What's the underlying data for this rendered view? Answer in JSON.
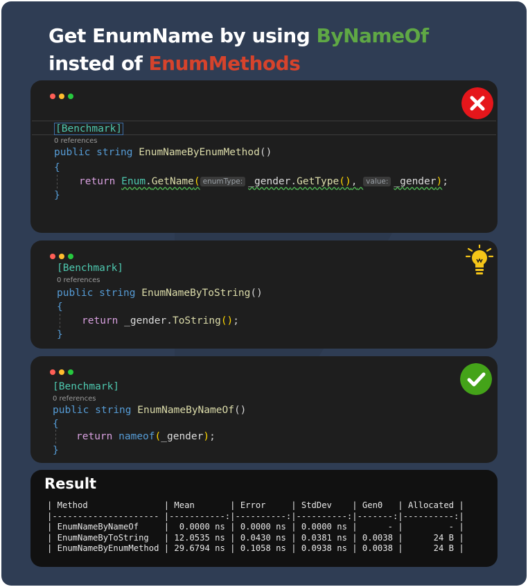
{
  "title": {
    "prefix1": "Get EnumName by using ",
    "highlight1": "ByNameOf",
    "prefix2": "insted of ",
    "highlight2": "EnumMethods"
  },
  "colors": {
    "green": "#5fa845",
    "red": "#d6432c",
    "background": "#2f3d54",
    "card": "#1e1e1e"
  },
  "cards": [
    {
      "status_icon": "close-icon",
      "attribute": "[Benchmark]",
      "references": "0 references",
      "signature": {
        "kw1": "public",
        "kw2": "string",
        "method": "EnumNameByEnumMethod",
        "parens": "()"
      },
      "open_brace": "{",
      "body": {
        "ret": "return",
        "type": "Enum",
        "dot1": ".",
        "fn": "GetName",
        "paren_open": "(",
        "hint1": "enumType:",
        "arg1": "_gender",
        "dot2": ".",
        "fn2": "GetType",
        "call_parens": "()",
        "comma": ",",
        "hint2": "value:",
        "arg2": "_gender",
        "paren_close": ")",
        "semi": ";"
      },
      "close_brace": "}"
    },
    {
      "status_icon": "lightbulb-icon",
      "attribute": "[Benchmark]",
      "references": "0 references",
      "signature": {
        "kw1": "public",
        "kw2": "string",
        "method": "EnumNameByToString",
        "parens": "()"
      },
      "open_brace": "{",
      "body": {
        "ret": "return",
        "arg": "_gender",
        "dot": ".",
        "fn": "ToString",
        "parens": "()",
        "semi": ";"
      },
      "close_brace": "}"
    },
    {
      "status_icon": "check-icon",
      "attribute": "[Benchmark]",
      "references": "0 references",
      "signature": {
        "kw1": "public",
        "kw2": "string",
        "method": "EnumNameByNameOf",
        "parens": "()"
      },
      "open_brace": "{",
      "body": {
        "ret": "return",
        "fn": "nameof",
        "paren_open": "(",
        "arg": "_gender",
        "paren_close": ")",
        "semi": ";"
      },
      "close_brace": "}"
    }
  ],
  "result": {
    "title": "Result",
    "table_rows": [
      "| Method               | Mean       | Error     | StdDev    | Gen0   | Allocated |",
      "|--------------------- |-----------:|----------:|----------:|-------:|----------:|",
      "| EnumNameByNameOf     |  0.0000 ns | 0.0000 ns | 0.0000 ns |      - |         - |",
      "| EnumNameByToString   | 12.0535 ns | 0.0430 ns | 0.0381 ns | 0.0038 |      24 B |",
      "| EnumNameByEnumMethod | 29.6794 ns | 0.1058 ns | 0.0938 ns | 0.0038 |      24 B |"
    ]
  }
}
